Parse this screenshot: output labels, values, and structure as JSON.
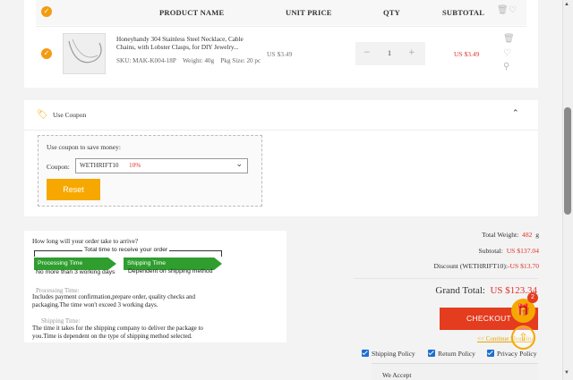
{
  "cart": {
    "headers": {
      "product_name": "PRODUCT NAME",
      "unit_price": "UNIT PRICE",
      "qty": "QTY",
      "subtotal": "SUBTOTAL"
    },
    "item": {
      "name": "Honeyhandy 304 Stainless Steel Necklace, Cable Chains, with Lobster Clasps, for DIY Jewelry...",
      "sku": "SKU: MAK-K004-18P",
      "weight": "Weight: 40g",
      "pkg_size": "Pkg Size: 20 pc",
      "unit_price": "US $3.49",
      "qty": "1",
      "subtotal": "US $3.49"
    }
  },
  "coupon": {
    "title": "Use Coupon",
    "save_label": "Use coupon to save money:",
    "coupon_label": "Coupon:",
    "selected_code": "WETHRIFT10",
    "selected_pct": "10%",
    "reset_label": "Reset"
  },
  "shipping": {
    "question": "How long will your order take to arrive?",
    "total_time_label": "Total time to receive your order",
    "processing_label": "Processing Time",
    "processing_sub": "No more than 3 working days",
    "shipping_label": "Shipping Time",
    "shipping_sub": "Dependent on shipping method",
    "processing_heading": "Processing Time:",
    "processing_text": "Includes payment confirmation,prepare order, quality checks and packaging.The time won't exceed 3 working days.",
    "shipping_heading": "Shipping Time:",
    "shipping_text": "The time it takes for the shipping company to deliver the package to you.Time is dependent on the type of shipping method selected."
  },
  "summary": {
    "total_weight_label": "Total Weight:",
    "total_weight_value": "482",
    "total_weight_unit": "g",
    "subtotal_label": "Subtotal:",
    "subtotal_value": "US $137.04",
    "discount_label": "Discount (WETHRIFT10):",
    "discount_value": "-US $13.70",
    "grand_label": "Grand Total:",
    "grand_value": "US $123.34",
    "checkout_label": "CHECKOUT",
    "continue_label": "<< Continue Shopping",
    "policies": [
      "Shipping Policy",
      "Return Policy",
      "Privacy Policy"
    ],
    "we_accept": "We Accept"
  },
  "floating": {
    "gift_badge": "2"
  },
  "colors": {
    "accent_orange": "#f6a800",
    "checkout_red": "#e43c1f",
    "price_red": "#e0322a",
    "timeline_green": "#2f9e2f"
  }
}
